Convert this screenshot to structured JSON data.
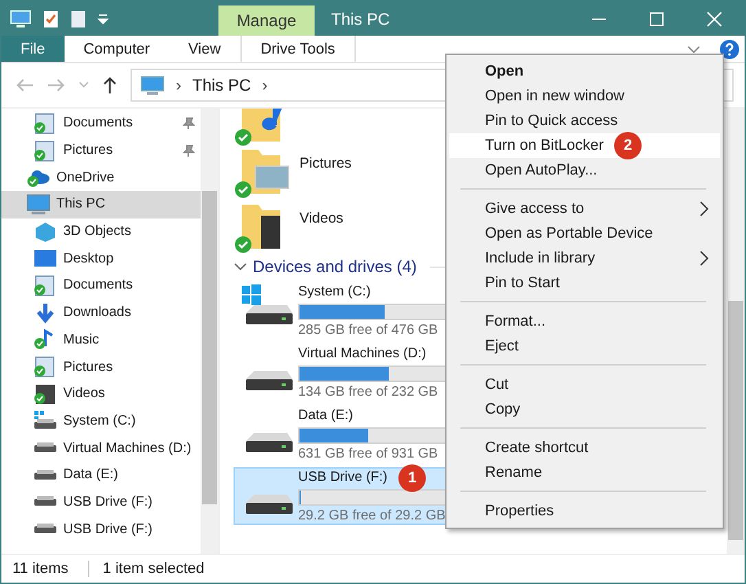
{
  "window": {
    "title": "This PC",
    "context_tab": "Manage"
  },
  "ribbon": {
    "tabs": [
      {
        "label": "File",
        "selected": true
      },
      {
        "label": "Computer",
        "selected": false
      },
      {
        "label": "View",
        "selected": false
      },
      {
        "label": "Drive Tools",
        "selected": false
      }
    ]
  },
  "address": {
    "separator_1": "›",
    "location": "This PC",
    "separator_2": "›"
  },
  "sidebar": {
    "items": [
      {
        "label": "Documents",
        "kind": "documents",
        "pinned": true,
        "synced": true
      },
      {
        "label": "Pictures",
        "kind": "pictures",
        "pinned": true,
        "synced": true
      },
      {
        "label": "OneDrive",
        "kind": "cloud",
        "pinned": false,
        "synced": true
      },
      {
        "label": "This PC",
        "kind": "pc",
        "selected": true,
        "children": [
          {
            "label": "3D Objects",
            "kind": "objects",
            "synced": false
          },
          {
            "label": "Desktop",
            "kind": "desktop",
            "synced": false
          },
          {
            "label": "Documents",
            "kind": "documents",
            "synced": true
          },
          {
            "label": "Downloads",
            "kind": "downloads",
            "synced": false
          },
          {
            "label": "Music",
            "kind": "music",
            "synced": true
          },
          {
            "label": "Pictures",
            "kind": "pictures",
            "synced": true
          },
          {
            "label": "Videos",
            "kind": "videos",
            "synced": true
          },
          {
            "label": "System (C:)",
            "kind": "system-drive",
            "synced": false
          },
          {
            "label": "Virtual Machines (D:)",
            "kind": "drive",
            "synced": false
          },
          {
            "label": "Data (E:)",
            "kind": "drive",
            "synced": false
          },
          {
            "label": "USB Drive (F:)",
            "kind": "drive",
            "synced": false
          },
          {
            "label": "USB Drive (F:)",
            "kind": "drive",
            "synced": false
          }
        ]
      }
    ]
  },
  "folders": [
    {
      "kind": "music",
      "synced": true
    },
    {
      "label": "Pictures",
      "kind": "pictures",
      "synced": true
    },
    {
      "label": "Videos",
      "kind": "videos",
      "synced": true
    }
  ],
  "devices": {
    "heading": "Devices and drives (4)",
    "drives": [
      {
        "name": "System (C:)",
        "kind": "system-drive",
        "level": 0.4,
        "free": "285 GB free of 476 GB",
        "selected": false
      },
      {
        "name": "Virtual Machines (D:)",
        "kind": "drive",
        "level": 0.42,
        "free": "134 GB free of 232 GB",
        "selected": false
      },
      {
        "name": "Data (E:)",
        "kind": "drive",
        "level": 0.32,
        "free": "631 GB free of 931 GB",
        "selected": false
      },
      {
        "name": "USB Drive (F:)",
        "kind": "drive",
        "level": 0,
        "free": "29.2 GB free of 29.2 GB",
        "selected": true,
        "callout": "1"
      }
    ]
  },
  "context_menu": {
    "items": [
      {
        "kind": "item",
        "label": "Open",
        "default": true
      },
      {
        "kind": "item",
        "label": "Open in new window"
      },
      {
        "kind": "item",
        "label": "Pin to Quick access"
      },
      {
        "kind": "item",
        "label": "Turn on BitLocker",
        "selected": true,
        "callout": "2"
      },
      {
        "kind": "item",
        "label": "Open AutoPlay..."
      },
      {
        "kind": "separator"
      },
      {
        "kind": "item",
        "label": "Give access to",
        "submenu": true
      },
      {
        "kind": "item",
        "label": "Open as Portable Device"
      },
      {
        "kind": "item",
        "label": "Include in library",
        "submenu": true
      },
      {
        "kind": "item",
        "label": "Pin to Start"
      },
      {
        "kind": "separator"
      },
      {
        "kind": "item",
        "label": "Format..."
      },
      {
        "kind": "item",
        "label": "Eject"
      },
      {
        "kind": "separator"
      },
      {
        "kind": "item",
        "label": "Cut"
      },
      {
        "kind": "item",
        "label": "Copy"
      },
      {
        "kind": "separator"
      },
      {
        "kind": "item",
        "label": "Create shortcut"
      },
      {
        "kind": "item",
        "label": "Rename"
      },
      {
        "kind": "separator"
      },
      {
        "kind": "item",
        "label": "Properties"
      }
    ]
  },
  "status_bar": {
    "items": "11 items",
    "selection": "1 item selected"
  }
}
